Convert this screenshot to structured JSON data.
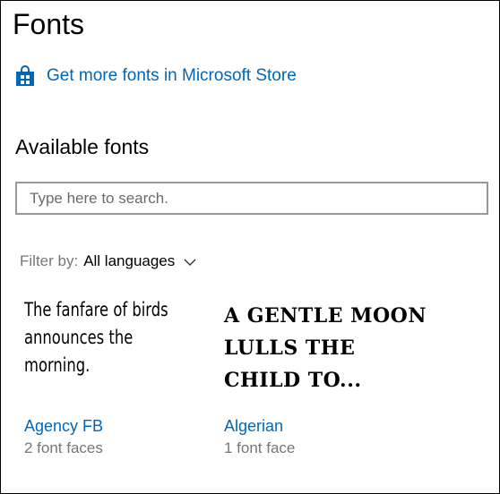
{
  "page": {
    "title": "Fonts"
  },
  "store_link": {
    "label": "Get more fonts in Microsoft Store",
    "icon": "store-bag-icon",
    "color": "#0067b8"
  },
  "available": {
    "title": "Available fonts"
  },
  "search": {
    "placeholder": "Type here to search.",
    "value": ""
  },
  "filter": {
    "label": "Filter by:",
    "value": "All languages",
    "icon": "chevron-down-icon"
  },
  "fonts": [
    {
      "sample": "The fanfare of birds announces the morning.",
      "name": "Agency FB",
      "faces": "2 font faces"
    },
    {
      "sample": "A GENTLE MOON LULLS THE CHILD TO...",
      "name": "Algerian",
      "faces": "1 font face"
    }
  ]
}
